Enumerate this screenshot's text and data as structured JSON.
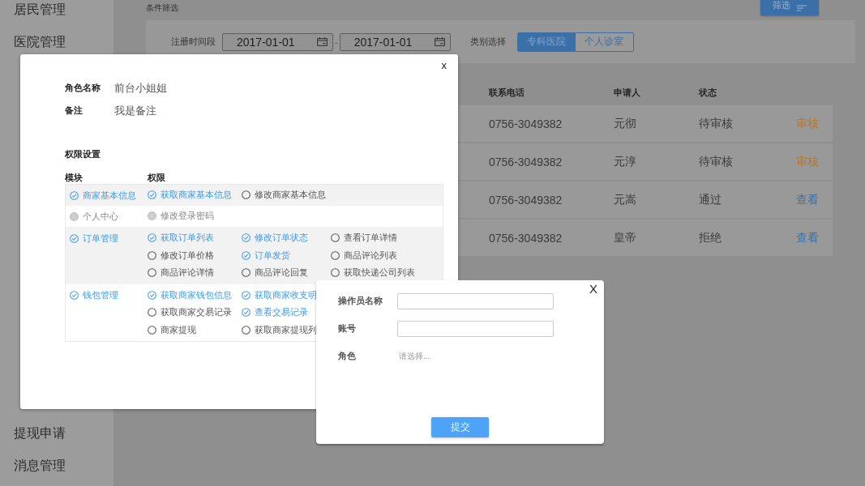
{
  "sidebar": {
    "items": [
      {
        "label": "居民管理"
      },
      {
        "label": "医院管理"
      }
    ],
    "bottom_items": [
      {
        "label": "提现申请"
      },
      {
        "label": "消息管理"
      }
    ]
  },
  "filter": {
    "title": "条件筛选",
    "button": "筛选",
    "date_label": "注册时间段",
    "date_from": "2017-01-01",
    "separator": "-",
    "date_to": "2017-01-01",
    "category_label": "类别选择",
    "categories": [
      {
        "label": "专科医院",
        "selected": true
      },
      {
        "label": "个人诊室",
        "selected": false
      }
    ]
  },
  "table": {
    "columns": [
      "联系电话",
      "申请人",
      "状态"
    ],
    "rows": [
      {
        "phone": "0756-3049382",
        "applicant": "元彻",
        "status": "待审核",
        "action": {
          "label": "审核",
          "kind": "review"
        }
      },
      {
        "phone": "0756-3049382",
        "applicant": "元淳",
        "status": "待审核",
        "action": {
          "label": "审核",
          "kind": "review"
        }
      },
      {
        "phone": "0756-3049382",
        "applicant": "元嵩",
        "status": "通过",
        "action": {
          "label": "查看",
          "kind": "view"
        }
      },
      {
        "phone": "0756-3049382",
        "applicant": "皇帝",
        "status": "拒绝",
        "action": {
          "label": "查看",
          "kind": "view"
        }
      }
    ]
  },
  "role_dialog": {
    "close": "x",
    "fields": [
      {
        "label": "角色名称",
        "value": "前台小姐姐"
      },
      {
        "label": "备注",
        "value": "我是备注"
      }
    ],
    "section_title": "权限设置",
    "columns": [
      "模块",
      "权限"
    ],
    "modules": [
      {
        "label": "商家基本信息",
        "checked": true,
        "disabled": false,
        "permission_rows": [
          [
            {
              "label": "获取商家基本信息",
              "checked": true,
              "disabled": false
            },
            {
              "label": "修改商家基本信息",
              "checked": false,
              "disabled": false
            }
          ]
        ]
      },
      {
        "label": "个人中心",
        "checked": false,
        "disabled": true,
        "permission_rows": [
          [
            {
              "label": "修改登录密码",
              "checked": false,
              "disabled": true
            }
          ]
        ]
      },
      {
        "label": "订单管理",
        "checked": true,
        "disabled": false,
        "permission_rows": [
          [
            {
              "label": "获取订单列表",
              "checked": true,
              "disabled": false
            },
            {
              "label": "修改订单状态",
              "checked": true,
              "disabled": false
            },
            {
              "label": "查看订单详情",
              "checked": false,
              "disabled": false
            }
          ],
          [
            {
              "label": "修改订单价格",
              "checked": false,
              "disabled": false
            },
            {
              "label": "订单发货",
              "checked": true,
              "disabled": false
            },
            {
              "label": "商品评论列表",
              "checked": false,
              "disabled": false
            }
          ],
          [
            {
              "label": "商品评论详情",
              "checked": false,
              "disabled": false
            },
            {
              "label": "商品评论回复",
              "checked": false,
              "disabled": false
            },
            {
              "label": "获取快递公司列表",
              "checked": false,
              "disabled": false
            }
          ]
        ]
      },
      {
        "label": "钱包管理",
        "checked": true,
        "disabled": false,
        "permission_rows": [
          [
            {
              "label": "获取商家钱包信息",
              "checked": true,
              "disabled": false
            },
            {
              "label": "获取商家收支明",
              "checked": true,
              "disabled": false
            }
          ],
          [
            {
              "label": "获取商家交易记录",
              "checked": false,
              "disabled": false
            },
            {
              "label": "查看交易记录",
              "checked": true,
              "disabled": false
            }
          ],
          [
            {
              "label": "商家提现",
              "checked": false,
              "disabled": false
            },
            {
              "label": "获取商家提现列",
              "checked": false,
              "disabled": false
            }
          ]
        ]
      }
    ]
  },
  "operator_dialog": {
    "close": "X",
    "fields": [
      {
        "label": "操作员名称",
        "kind": "text"
      },
      {
        "label": "账号",
        "kind": "text"
      },
      {
        "label": "角色",
        "kind": "select",
        "placeholder": "请选择..."
      }
    ],
    "submit": "提交"
  }
}
